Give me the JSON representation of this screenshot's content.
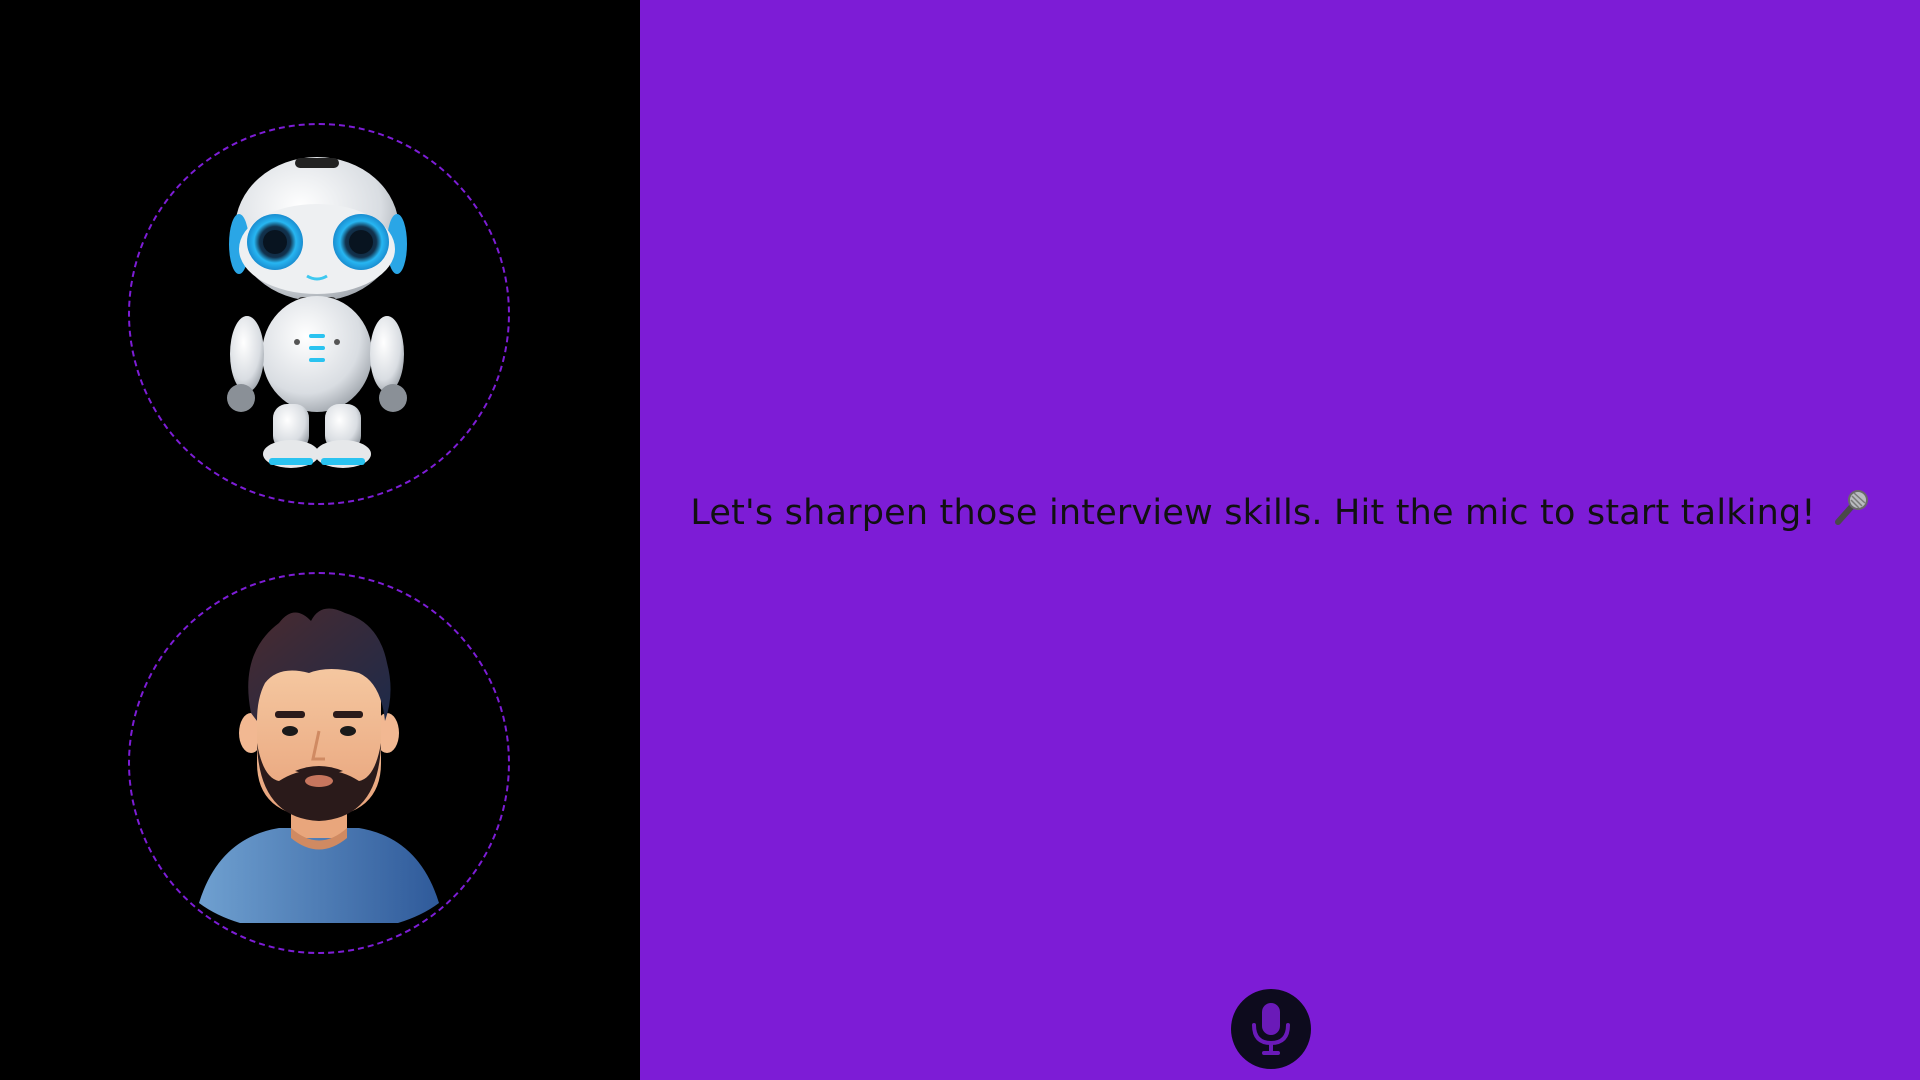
{
  "main": {
    "prompt_text": "Let's sharpen those interview skills. Hit the mic to start talking!"
  },
  "sidebar": {
    "ai_avatar": {
      "icon": "robot-avatar"
    },
    "user_avatar": {
      "icon": "user-avatar"
    }
  },
  "controls": {
    "mic_icon": "microphone-icon"
  },
  "colors": {
    "sidebar_bg": "#000000",
    "main_bg": "#7d1cd6",
    "ring": "#7d1dd6",
    "mic_bg": "#0d0b1d",
    "mic_icon": "#6a1ab8"
  }
}
